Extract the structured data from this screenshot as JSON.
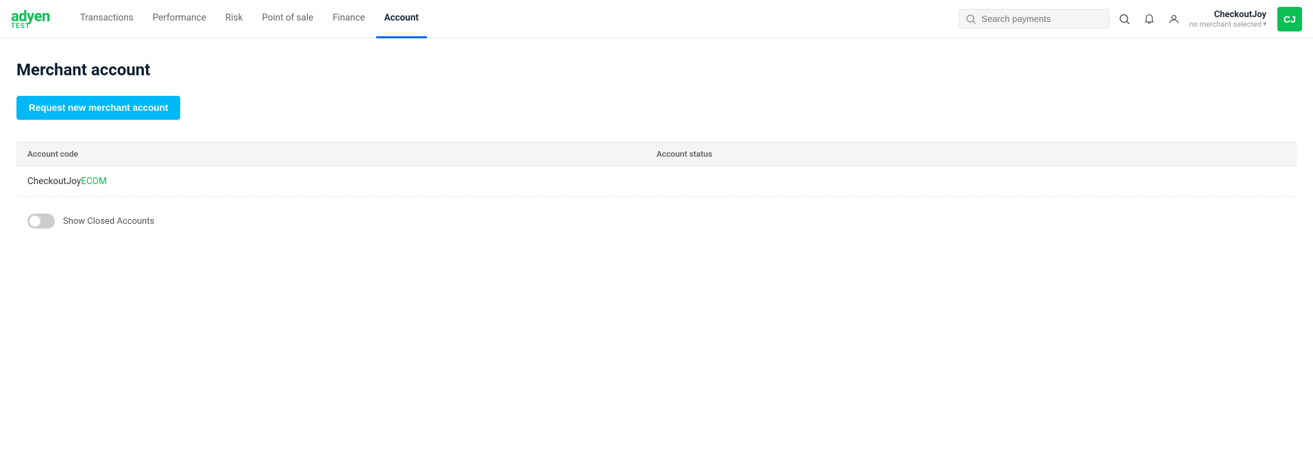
{
  "brand": {
    "name": "adyen",
    "env": "TEST"
  },
  "nav": {
    "links": [
      {
        "id": "transactions",
        "label": "Transactions",
        "active": false
      },
      {
        "id": "performance",
        "label": "Performance",
        "active": false
      },
      {
        "id": "risk",
        "label": "Risk",
        "active": false
      },
      {
        "id": "point-of-sale",
        "label": "Point of sale",
        "active": false
      },
      {
        "id": "finance",
        "label": "Finance",
        "active": false
      },
      {
        "id": "account",
        "label": "Account",
        "active": true
      }
    ],
    "search_placeholder": "Search payments",
    "user": {
      "name": "CheckoutJoy",
      "merchant": "no merchant selected",
      "avatar_initials": "CJ"
    }
  },
  "page": {
    "title": "Merchant account",
    "request_button_label": "Request new merchant account"
  },
  "table": {
    "headers": [
      {
        "id": "account-code",
        "label": "Account code"
      },
      {
        "id": "account-status",
        "label": "Account status"
      }
    ],
    "rows": [
      {
        "account_code_prefix": "CheckoutJoy",
        "account_code_suffix": "ECOM",
        "account_status": ""
      }
    ]
  },
  "toggle": {
    "label": "Show Closed Accounts",
    "checked": false
  }
}
